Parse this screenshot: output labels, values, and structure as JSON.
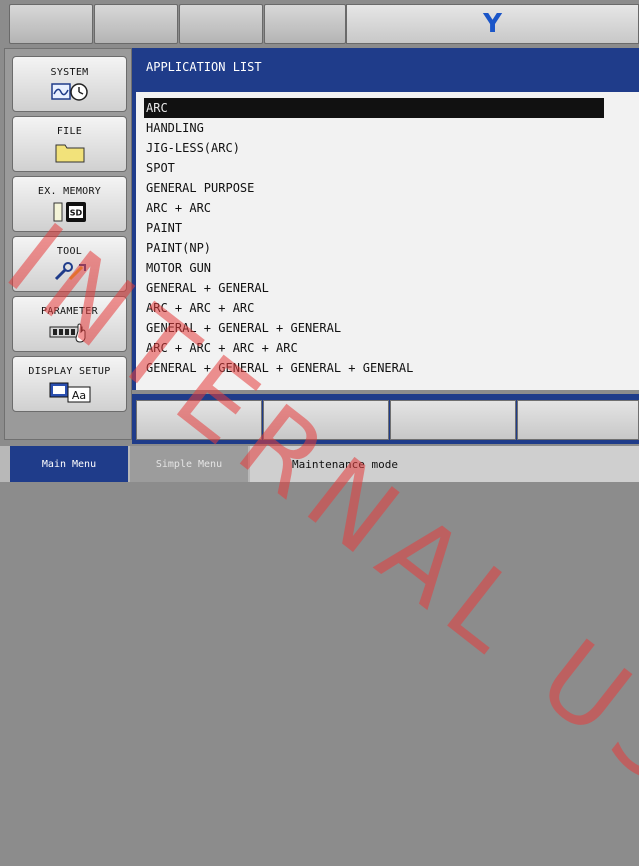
{
  "header": {
    "logo_text": "Y",
    "logo_color": "#1a55c8"
  },
  "left_menu": {
    "items": [
      {
        "label": "SYSTEM",
        "icon": "system-clock-icon"
      },
      {
        "label": "FILE",
        "icon": "folder-icon"
      },
      {
        "label": "EX. MEMORY",
        "icon": "sd-card-icon"
      },
      {
        "label": "TOOL",
        "icon": "tool-wrench-icon"
      },
      {
        "label": "PARAMETER",
        "icon": "parameter-hand-icon"
      },
      {
        "label": "DISPLAY SETUP",
        "icon": "display-setup-icon"
      }
    ]
  },
  "main": {
    "title": "APPLICATION LIST",
    "selected_index": 0,
    "items": [
      "ARC",
      "HANDLING",
      "JIG-LESS(ARC)",
      "SPOT",
      "GENERAL PURPOSE",
      "ARC + ARC",
      "PAINT",
      "PAINT(NP)",
      "MOTOR GUN",
      "GENERAL + GENERAL",
      "ARC + ARC + ARC",
      "GENERAL + GENERAL + GENERAL",
      "ARC + ARC + ARC + ARC",
      "GENERAL + GENERAL + GENERAL + GENERAL"
    ]
  },
  "status_bar": {
    "main_menu": "Main Menu",
    "simple_menu": "Simple Menu",
    "mode": "Maintenance mode"
  },
  "watermark": "INTERNAL USE",
  "colors": {
    "title_bar": "#1f3c8a",
    "watermark": "#e63c3c"
  }
}
